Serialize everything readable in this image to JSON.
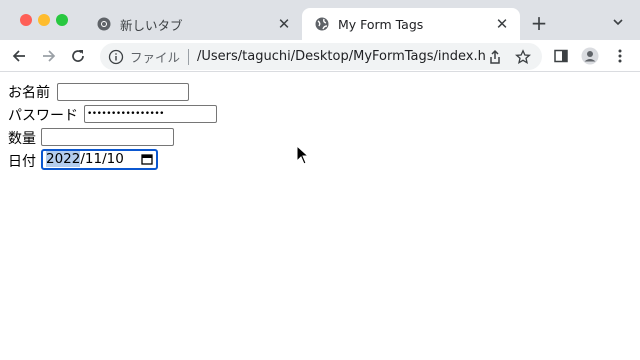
{
  "window": {
    "tabs": [
      {
        "title": "新しいタブ",
        "icon": "chrome-icon",
        "active": false
      },
      {
        "title": "My Form Tags",
        "icon": "globe-icon",
        "active": true
      }
    ],
    "new_tab_symbol": "+",
    "close_symbol": "✕"
  },
  "toolbar": {
    "file_label": "ファイル",
    "url": "/Users/taguchi/Desktop/MyFormTags/index.ht..."
  },
  "form": {
    "name_label": "お名前",
    "name_value": "",
    "password_label": "パスワード",
    "password_value": "••••••••••••••••",
    "quantity_label": "数量",
    "quantity_value": "",
    "date_label": "日付",
    "date_year": "2022",
    "date_rest": "/11/10"
  },
  "colors": {
    "tabstrip": "#dee1e6",
    "focus_ring": "#0b57d0",
    "selection": "#b4cdee"
  }
}
